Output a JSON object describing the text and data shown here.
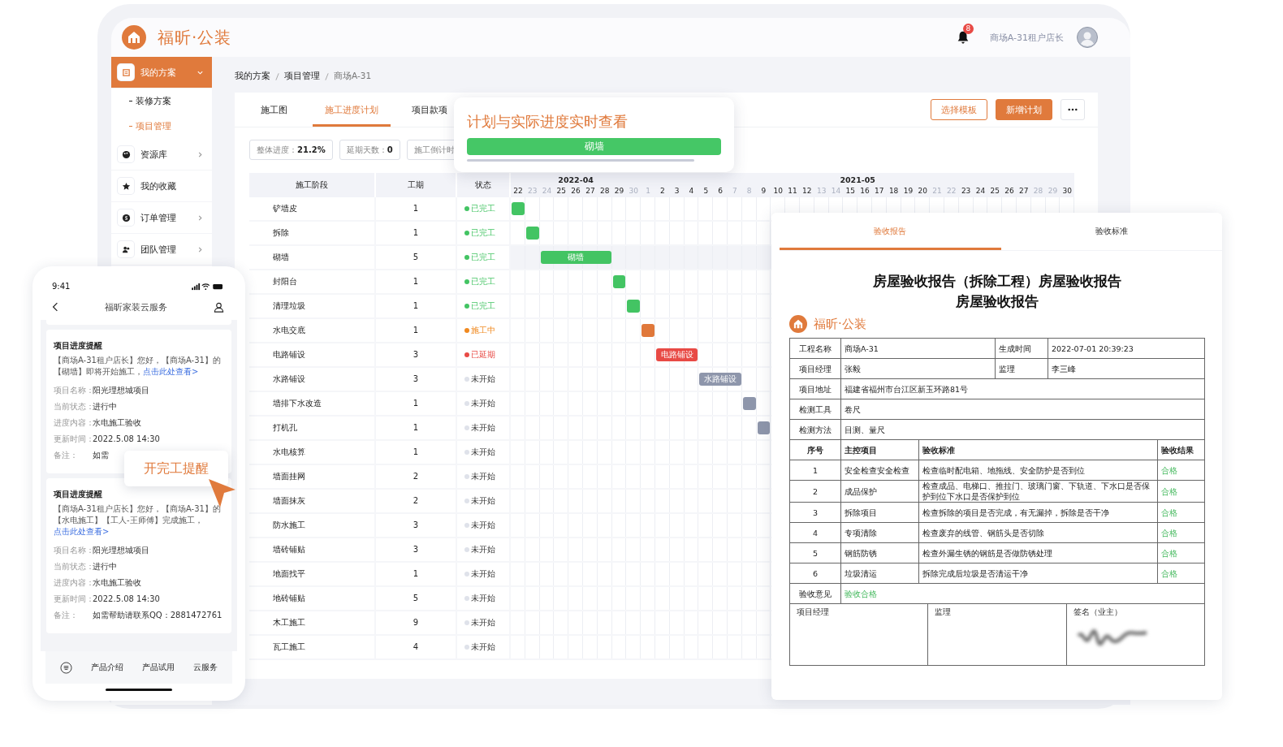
{
  "header": {
    "brand": "福昕·公装",
    "notifications": "8",
    "user": "商场A-31租户店长"
  },
  "sidebar": {
    "items": [
      {
        "label": "我的方案",
        "selected": true,
        "expanded": true,
        "children": [
          {
            "label": "装修方案",
            "selected": false
          },
          {
            "label": "项目管理",
            "selected": true
          }
        ]
      },
      {
        "label": "资源库",
        "selected": false,
        "expanded": false
      },
      {
        "label": "我的收藏",
        "selected": false
      },
      {
        "label": "订单管理",
        "selected": false,
        "expanded": false
      },
      {
        "label": "团队管理",
        "selected": false,
        "expanded": false
      }
    ]
  },
  "breadcrumb": [
    "我的方案",
    "项目管理",
    "商场A-31"
  ],
  "tabs": [
    {
      "label": "施工图",
      "selected": false
    },
    {
      "label": "施工进度计划",
      "selected": true
    },
    {
      "label": "项目款项",
      "selected": false
    }
  ],
  "actions": [
    {
      "label": "选择模板",
      "kind": "outline"
    },
    {
      "label": "新增计划",
      "kind": "primary"
    },
    {
      "kind": "more"
    }
  ],
  "stats": [
    {
      "label": "整体进度：",
      "value": "21.2%"
    },
    {
      "label": "延期天数：",
      "value": "0"
    },
    {
      "label": "施工倒计时"
    }
  ],
  "gantt": {
    "columns": [
      "施工阶段",
      "工期",
      "状态"
    ],
    "months": [
      {
        "label": "2022-04",
        "days": [
          {
            "day": "22",
            "weekend": false
          },
          {
            "day": "23",
            "weekend": true
          },
          {
            "day": "24",
            "weekend": true
          },
          {
            "day": "25",
            "weekend": false
          },
          {
            "day": "26",
            "weekend": false
          },
          {
            "day": "27",
            "weekend": false
          },
          {
            "day": "28",
            "weekend": false
          },
          {
            "day": "29",
            "weekend": false
          },
          {
            "day": "30",
            "weekend": true
          }
        ]
      },
      {
        "label": "2021-05",
        "days": [
          {
            "day": "1",
            "weekend": true
          },
          {
            "day": "2",
            "weekend": false
          },
          {
            "day": "3",
            "weekend": false
          },
          {
            "day": "4",
            "weekend": false
          },
          {
            "day": "5",
            "weekend": false
          },
          {
            "day": "6",
            "weekend": false
          },
          {
            "day": "7",
            "weekend": true
          },
          {
            "day": "8",
            "weekend": true
          },
          {
            "day": "9",
            "weekend": false
          },
          {
            "day": "10",
            "weekend": false
          },
          {
            "day": "11",
            "weekend": false
          },
          {
            "day": "12",
            "weekend": false
          },
          {
            "day": "13",
            "weekend": true
          },
          {
            "day": "14",
            "weekend": true
          },
          {
            "day": "15",
            "weekend": false
          },
          {
            "day": "16",
            "weekend": false
          },
          {
            "day": "17",
            "weekend": false
          },
          {
            "day": "18",
            "weekend": false
          },
          {
            "day": "19",
            "weekend": false
          },
          {
            "day": "20",
            "weekend": false
          },
          {
            "day": "21",
            "weekend": true
          },
          {
            "day": "22",
            "weekend": true
          },
          {
            "day": "23",
            "weekend": false
          },
          {
            "day": "24",
            "weekend": false
          },
          {
            "day": "25",
            "weekend": false
          },
          {
            "day": "26",
            "weekend": false
          },
          {
            "day": "27",
            "weekend": false
          },
          {
            "day": "28",
            "weekend": true
          },
          {
            "day": "29",
            "weekend": true
          },
          {
            "day": "30",
            "weekend": false
          }
        ]
      }
    ],
    "rows": [
      {
        "stage": "铲墙皮",
        "duration": "1",
        "status": "已完工",
        "kind": "done",
        "selected": false,
        "bar": {
          "kind": "plain"
        }
      },
      {
        "stage": "拆除",
        "duration": "1",
        "status": "已完工",
        "kind": "done",
        "selected": false,
        "bar": {
          "kind": "plain"
        }
      },
      {
        "stage": "砌墙",
        "duration": "5",
        "status": "已完工",
        "kind": "done",
        "selected": true,
        "bar": {
          "kind": "labeled",
          "label": "砌墙"
        }
      },
      {
        "stage": "封阳台",
        "duration": "1",
        "status": "已完工",
        "kind": "done",
        "selected": false,
        "bar": {
          "kind": "plain"
        }
      },
      {
        "stage": "清理垃圾",
        "duration": "1",
        "status": "已完工",
        "kind": "done",
        "selected": false,
        "bar": {
          "kind": "plain"
        }
      },
      {
        "stage": "水电交底",
        "duration": "1",
        "status": "施工中",
        "kind": "progress",
        "selected": false,
        "bar": {
          "kind": "plain"
        }
      },
      {
        "stage": "电路铺设",
        "duration": "3",
        "status": "已延期",
        "kind": "delayed",
        "selected": false,
        "bar": {
          "kind": "labeled",
          "label": "电路铺设"
        }
      },
      {
        "stage": "水路铺设",
        "duration": "3",
        "status": "未开始",
        "kind": "todo",
        "selected": false,
        "bar": {
          "kind": "labeled",
          "label": "水路铺设"
        }
      },
      {
        "stage": "墙排下水改造",
        "duration": "1",
        "status": "未开始",
        "kind": "todo",
        "selected": false,
        "bar": {
          "kind": "plain"
        }
      },
      {
        "stage": "打机孔",
        "duration": "1",
        "status": "未开始",
        "kind": "todo",
        "selected": false,
        "bar": {
          "kind": "plain"
        }
      },
      {
        "stage": "水电核算",
        "duration": "1",
        "status": "未开始",
        "kind": "todo",
        "selected": false
      },
      {
        "stage": "墙面挂网",
        "duration": "2",
        "status": "未开始",
        "kind": "todo",
        "selected": false
      },
      {
        "stage": "墙面抹灰",
        "duration": "2",
        "status": "未开始",
        "kind": "todo",
        "selected": false
      },
      {
        "stage": "防水施工",
        "duration": "3",
        "status": "未开始",
        "kind": "todo",
        "selected": false
      },
      {
        "stage": "墙砖铺贴",
        "duration": "3",
        "status": "未开始",
        "kind": "todo",
        "selected": false
      },
      {
        "stage": "地面找平",
        "duration": "1",
        "status": "未开始",
        "kind": "todo",
        "selected": false
      },
      {
        "stage": "地砖铺贴",
        "duration": "5",
        "status": "未开始",
        "kind": "todo",
        "selected": false
      },
      {
        "stage": "木工施工",
        "duration": "9",
        "status": "未开始",
        "kind": "todo",
        "selected": false
      },
      {
        "stage": "瓦工施工",
        "duration": "4",
        "status": "未开始",
        "kind": "todo",
        "selected": false
      }
    ]
  },
  "tooltip": {
    "title": "计划与实际进度实时查看",
    "bar_label": "砌墙"
  },
  "phone": {
    "time": "9:41",
    "title": "福昕家装云服务",
    "cards": [
      {
        "title": "项目进度提醒",
        "message": "【商场A-31租户店长】您好，【商场A-31】的【砌墙】即将开始施工，",
        "link": "点击此处查看>",
        "fields": [
          {
            "label": "项目名称：",
            "value": "阳光理想城项目"
          },
          {
            "label": "当前状态：",
            "value": "进行中"
          },
          {
            "label": "进度内容：",
            "value": "水电施工验收"
          },
          {
            "label": "更新时间：",
            "value": "2022.5.08  14:30"
          },
          {
            "label": "备注：",
            "value": "如需"
          }
        ]
      },
      {
        "title": "项目进度提醒",
        "message": "【商场A-31租户店长】您好，【商场A-31】的【水电施工】【工人-王师傅】完成施工，",
        "link": "点击此处查看>",
        "fields": [
          {
            "label": "项目名称：",
            "value": "阳光理想城项目"
          },
          {
            "label": "当前状态：",
            "value": "进行中"
          },
          {
            "label": "进度内容：",
            "value": "水电施工验收"
          },
          {
            "label": "更新时间：",
            "value": "2022.5.08  14:30"
          },
          {
            "label": "备注：",
            "value": "如需帮助请联系QQ：2881472761"
          }
        ]
      }
    ],
    "tabs": [
      "产品介绍",
      "产品试用",
      "云服务"
    ]
  },
  "callout": "开完工提醒",
  "report": {
    "tabs": [
      {
        "label": "验收报告",
        "selected": true
      },
      {
        "label": "验收标准",
        "selected": false
      }
    ],
    "title": [
      "房屋验收报告（拆除工程）房屋验收报告",
      "房屋验收报告"
    ],
    "brand": "福昕·公装",
    "info": [
      [
        "工程名称",
        "商场A-31",
        "生成时间",
        "2022-07-01 20:39:23"
      ],
      [
        "项目经理",
        "张毅",
        "监理",
        "李三峰"
      ],
      [
        "项目地址",
        "福建省福州市台江区新玉环路81号"
      ],
      [
        "检测工具",
        "卷尺"
      ],
      [
        "检测方法",
        "目测、量尺"
      ]
    ],
    "columns": [
      "序号",
      "主控项目",
      "验收标准",
      "验收结果"
    ],
    "items": [
      [
        "1",
        "安全检查安全检查",
        "检查临时配电箱、地拖线、安全防护是否到位",
        "合格"
      ],
      [
        "2",
        "成品保护",
        "检查成品、电梯口、推拉门、玻璃门窗、下轨道、下水口是否保护到位下水口是否保护到位",
        "合格"
      ],
      [
        "3",
        "拆除项目",
        "检查拆除的项目是否完成，有无漏掉，拆除是否干净",
        "合格"
      ],
      [
        "4",
        "专项清除",
        "检查废弃的线管、钢筋头是否切除",
        "合格"
      ],
      [
        "5",
        "钢筋防锈",
        "检查外漏生锈的钢筋是否做防锈处理",
        "合格"
      ],
      [
        "6",
        "垃圾清运",
        "拆除完成后垃圾是否清运干净",
        "合格"
      ]
    ],
    "opinion": {
      "label": "验收意见",
      "value": "验收合格"
    },
    "signatures": [
      "项目经理",
      "监理",
      "签名（业主）"
    ]
  }
}
